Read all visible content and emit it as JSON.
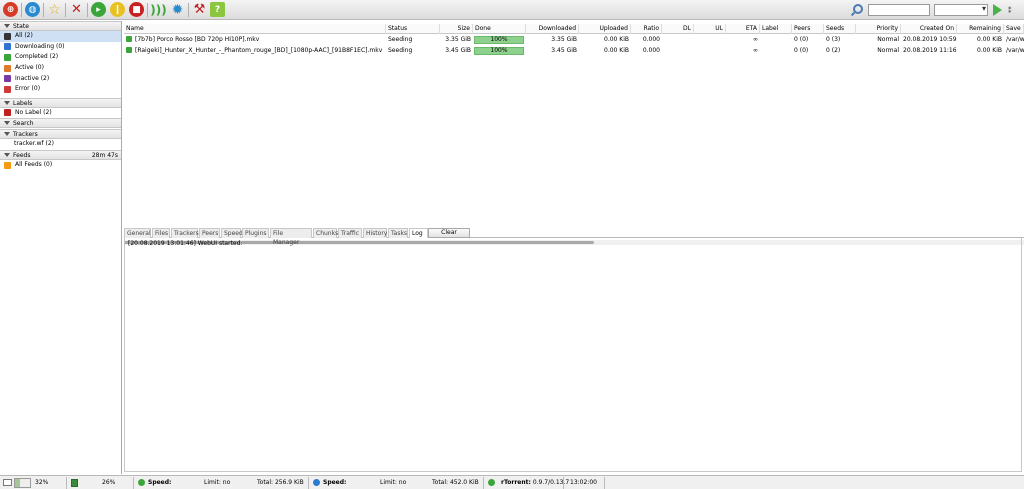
{
  "toolbar": {
    "buttons": [
      "add-torrent-icon",
      "add-url-icon",
      "create-icon",
      "remove-icon",
      "start-icon",
      "pause-icon",
      "stop-icon",
      "rss-icon",
      "settings-icon",
      "plugins-icon",
      "help-icon"
    ],
    "help_label": "?",
    "search_placeholder": ""
  },
  "sidebar": {
    "state_header": "State",
    "state_items": [
      {
        "label": "All (2)",
        "color": "#333333"
      },
      {
        "label": "Downloading (0)",
        "color": "#2f74d0"
      },
      {
        "label": "Completed (2)",
        "color": "#3aa63a"
      },
      {
        "label": "Active (0)",
        "color": "#e07a2a"
      },
      {
        "label": "Inactive (2)",
        "color": "#7a3aa6"
      },
      {
        "label": "Error (0)",
        "color": "#d03a3a"
      }
    ],
    "labels_header": "Labels",
    "labels_items": [
      {
        "label": "No Label (2)",
        "color": "#c02020"
      }
    ],
    "search_header": "Search",
    "trackers_header": "Trackers",
    "trackers_items": [
      {
        "label": "tracker.wf (2)"
      }
    ],
    "feeds_header": "Feeds",
    "feeds_timer": "28m 47s",
    "feeds_items": [
      {
        "label": "All Feeds (0)",
        "color": "#f39c12"
      }
    ]
  },
  "table": {
    "columns": [
      "Name",
      "Status",
      "Size",
      "Done",
      "Downloaded",
      "Uploaded",
      "Ratio",
      "DL",
      "UL",
      "ETA",
      "Label",
      "Peers",
      "Seeds",
      "Priority",
      "Created On",
      "Remaining",
      "Save"
    ],
    "rows": [
      {
        "name": "[7b7b] Porco Rosso [BD 720p HI10P].mkv",
        "status": "Seeding",
        "size": "3.35 GiB",
        "done": "100%",
        "downloaded": "3.35 GiB",
        "uploaded": "0.00 KiB",
        "ratio": "0.000",
        "dl": "",
        "ul": "",
        "eta": "∞",
        "label": "",
        "peers": "0 (0)",
        "seeds": "0 (3)",
        "priority": "Normal",
        "created": "20.08.2019 10:59:02",
        "remaining": "0.00 KiB",
        "save": "/var/w"
      },
      {
        "name": "[Raigeki]_Hunter_X_Hunter_-_Phantom_rouge_[BD]_[1080p-AAC]_[91B8F1EC].mkv",
        "status": "Seeding",
        "size": "3.45 GiB",
        "done": "100%",
        "downloaded": "3.45 GiB",
        "uploaded": "0.00 KiB",
        "ratio": "0.000",
        "dl": "",
        "ul": "",
        "eta": "∞",
        "label": "",
        "peers": "0 (0)",
        "seeds": "0 (2)",
        "priority": "Normal",
        "created": "20.08.2019 11:16:25",
        "remaining": "0.00 KiB",
        "save": "/var/w"
      }
    ],
    "done_fraction": 1.0
  },
  "tabs": {
    "items": [
      "General",
      "Files",
      "Trackers",
      "Peers",
      "Speed",
      "Plugins",
      "File Manager",
      "Chunks",
      "Traffic",
      "History",
      "Tasks",
      "Log"
    ],
    "active": "Log",
    "clear_label": "Clear"
  },
  "log": {
    "line": "[20.08.2019 13:01:46] WebUI started."
  },
  "status": {
    "disk_pct": "32%",
    "cpu_pct": "26%",
    "disk_fraction": 0.32,
    "dl_speed_label": "Speed:",
    "dl_limit_label": "Limit: no",
    "dl_total": "Total: 256.9 KiB",
    "ul_speed_label": "Speed:",
    "ul_limit_label": "Limit: no",
    "ul_total": "Total: 452.0 KiB",
    "client": "rTorrent: 0.9.7/0.13.7",
    "time": "13:02:00"
  },
  "colors": {
    "accent_green": "#8ed08e",
    "selected": "#cfe0f5"
  }
}
